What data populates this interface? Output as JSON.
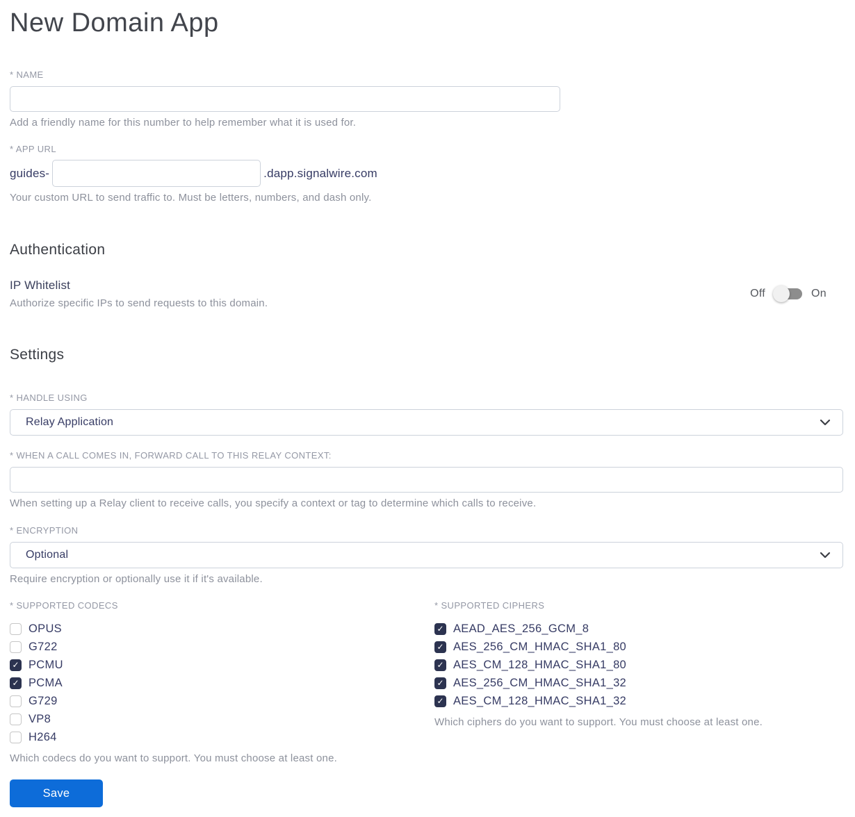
{
  "page": {
    "title": "New Domain App"
  },
  "name_field": {
    "label": "* NAME",
    "value": "",
    "helper": "Add a friendly name for this number to help remember what it is used for."
  },
  "app_url": {
    "label": "* APP URL",
    "prefix": "guides-",
    "value": "",
    "suffix": ".dapp.signalwire.com",
    "helper": "Your custom URL to send traffic to. Must be letters, numbers, and dash only."
  },
  "authentication": {
    "heading": "Authentication",
    "ip_whitelist": {
      "label": "IP Whitelist",
      "helper": "Authorize specific IPs to send requests to this domain.",
      "off_label": "Off",
      "on_label": "On",
      "enabled": false
    }
  },
  "settings": {
    "heading": "Settings",
    "handle_using": {
      "label": "* HANDLE USING",
      "value": "Relay Application"
    },
    "relay_context": {
      "label": "* WHEN A CALL COMES IN, FORWARD CALL TO THIS RELAY CONTEXT:",
      "value": "",
      "helper": "When setting up a Relay client to receive calls, you specify a context or tag to determine which calls to receive."
    },
    "encryption": {
      "label": "* ENCRYPTION",
      "value": "Optional",
      "helper": "Require encryption or optionally use it if it's available."
    },
    "codecs": {
      "label": "* SUPPORTED CODECS",
      "helper": "Which codecs do you want to support. You must choose at least one.",
      "items": [
        {
          "label": "OPUS",
          "checked": false
        },
        {
          "label": "G722",
          "checked": false
        },
        {
          "label": "PCMU",
          "checked": true
        },
        {
          "label": "PCMA",
          "checked": true
        },
        {
          "label": "G729",
          "checked": false
        },
        {
          "label": "VP8",
          "checked": false
        },
        {
          "label": "H264",
          "checked": false
        }
      ]
    },
    "ciphers": {
      "label": "* SUPPORTED CIPHERS",
      "helper": "Which ciphers do you want to support. You must choose at least one.",
      "items": [
        {
          "label": "AEAD_AES_256_GCM_8",
          "checked": true
        },
        {
          "label": "AES_256_CM_HMAC_SHA1_80",
          "checked": true
        },
        {
          "label": "AES_CM_128_HMAC_SHA1_80",
          "checked": true
        },
        {
          "label": "AES_256_CM_HMAC_SHA1_32",
          "checked": true
        },
        {
          "label": "AES_CM_128_HMAC_SHA1_32",
          "checked": true
        }
      ]
    }
  },
  "actions": {
    "save_label": "Save"
  },
  "colors": {
    "accent_blue": "#0d6cd9",
    "checkbox_navy": "#2c3350",
    "border_gray": "#ccd2db",
    "text_navy": "#363b64"
  }
}
